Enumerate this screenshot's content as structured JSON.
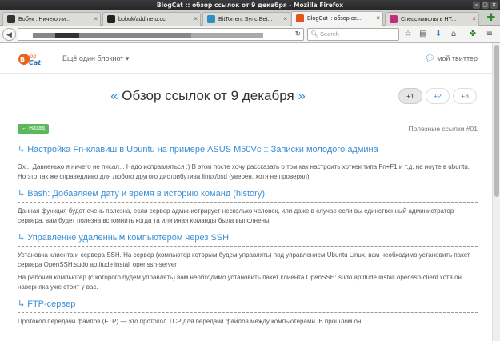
{
  "window": {
    "title": "BlogCat :: обзор ссылок от 9 декабря - Mozilla Firefox"
  },
  "tabs": [
    {
      "label": "Бобук : Ничего ли...",
      "icon": "cat-icon",
      "color": "#333333"
    },
    {
      "label": "bobuk/addmeto.cc",
      "icon": "github-icon",
      "color": "#222222"
    },
    {
      "label": "BitTorrent Sync Bet...",
      "icon": "sync-icon",
      "color": "#2f8fbf"
    },
    {
      "label": "BlogCat :: обзор сс...",
      "icon": "blogcat-icon",
      "color": "#e0561c"
    },
    {
      "label": "Спецсимволы в HT...",
      "icon": "s-icon",
      "color": "#c0307a"
    }
  ],
  "nav": {
    "search_placeholder": "Search"
  },
  "site": {
    "notebook_label": "Ещё один блокнот ▾",
    "twitter_label": "мой твиттер"
  },
  "post": {
    "quote_left": "«",
    "title": "Обзор ссылок от 9 декабря",
    "quote_right": "»",
    "pages": [
      "+1",
      "+2",
      "+3"
    ],
    "back_label": "← Назад",
    "tagline": "Полезные ссылки #01",
    "items": [
      {
        "title": "Настройка Fn-клавиш в Ubuntu на примере ASUS M50Vc :: Записки молодого админа",
        "paragraphs": [
          "Эх... Давненько я ничего не писал... Надо исправляться :) В этом посте хочу рассказать о том как настроить хоткеи типа Fn+F1 и т.д. на ноуте в ubuntu. Но это так же справедливо для любого другого дистрибутива linux/bsd (уверен, хотя не проверял)."
        ]
      },
      {
        "title": "Bash: Добавляем дату и время в историю команд (history)",
        "paragraphs": [
          "Данная функция будет очень полезна, если сервер администрирует несколько человек, или даже в случае если вы единственный администратор сервера, вам будет полезна вспомнить когда та или иная команды была выполнены."
        ]
      },
      {
        "title": "Управление удаленным компьютером через SSH",
        "paragraphs": [
          "Установка клиента и сервера SSH. На сервер (компьютер которым будем управлять) под управлением Ubuntu Linux, вам необходимо установить пакет сервера OpenSSH:sudo aptitude install openssh-server",
          "На рабочий компьютер (с которого будем управлять) вам необходимо установить пакет клиента OpenSSH: sudo aptitude install openssh-client хотя он наверняка уже стоит у вас."
        ]
      },
      {
        "title": "FTP-сервер",
        "paragraphs": [
          "Протокол передачи файлов (FTP) — это протокол TCP для передачи файлов между компьютерами. В прошлом он"
        ]
      }
    ]
  }
}
